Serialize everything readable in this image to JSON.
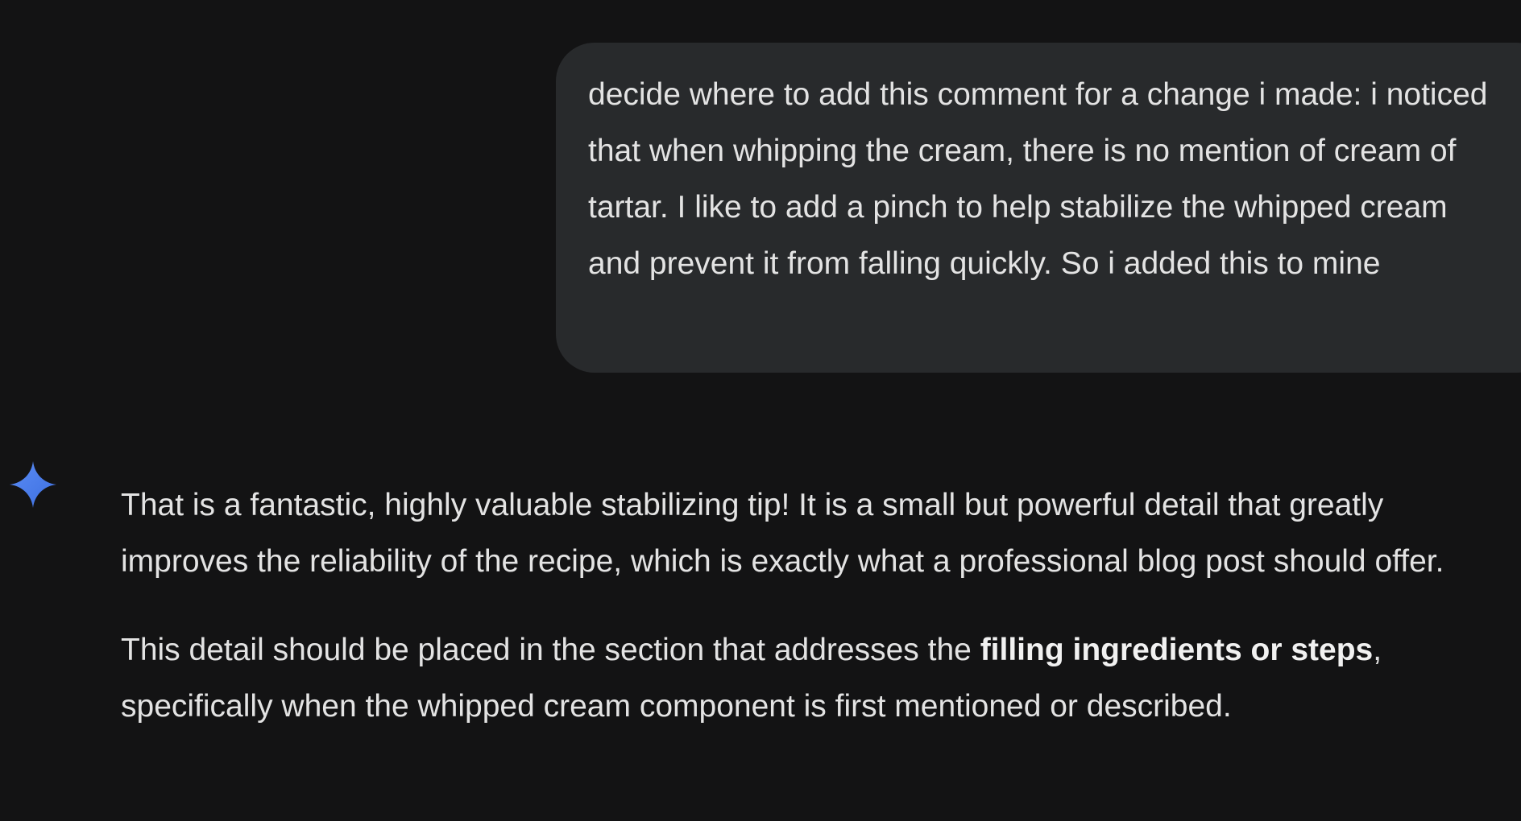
{
  "user_message": {
    "text": "decide where to add this comment for a change i made: i noticed that when whipping the cream, there is no mention of cream of tartar. I like to add a pinch to help stabilize the whipped cream and prevent it from falling quickly. So i added this to mine"
  },
  "assistant": {
    "icon": "sparkle-icon",
    "accent_color": "#4285f4",
    "paragraph1": "That is a fantastic, highly valuable stabilizing tip! It is a small but powerful detail that greatly improves the reliability of the recipe, which is exactly what a professional blog post should offer.",
    "paragraph2_before": "This detail should be placed in the section that addresses the ",
    "paragraph2_bold": "filling ingredients or steps",
    "paragraph2_after": ", specifically when the whipped cream component is first mentioned or described."
  },
  "colors": {
    "background": "#131314",
    "bubble": "#282a2c",
    "text": "#e3e3e3"
  }
}
